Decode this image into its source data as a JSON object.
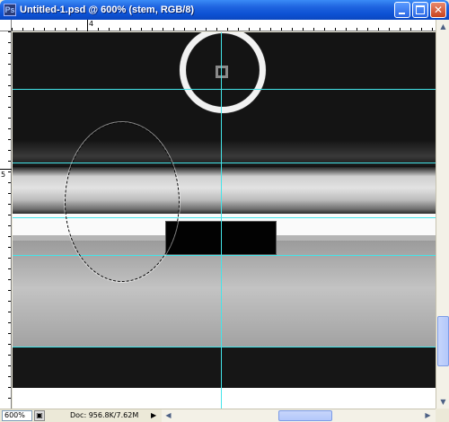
{
  "window": {
    "title": "Untitled-1.psd @ 600% (stem, RGB/8)",
    "app_icon": "photoshop-icon",
    "title_color": "#0d52d4"
  },
  "ruler": {
    "top_label": "4",
    "left_label": "5"
  },
  "canvas": {
    "guide_color": "#43e5ea"
  },
  "statusbar": {
    "zoom": "600%",
    "doc": "Doc: 956.8K/7.62M",
    "menu_arrow": "▶"
  },
  "scrollbars": {
    "left_arrow": "◀",
    "right_arrow": "▶",
    "up_arrow": "▲",
    "down_arrow": "▼"
  }
}
